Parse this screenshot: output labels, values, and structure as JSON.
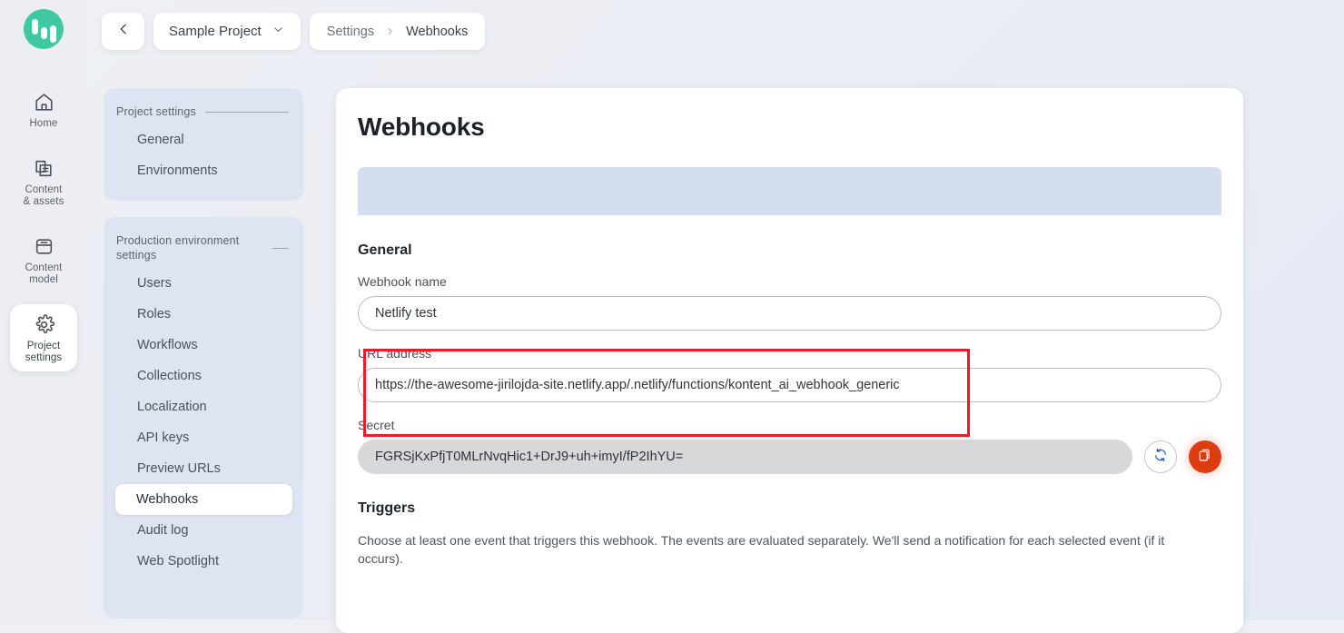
{
  "app": {
    "logo_name": "kontent-ai-logo",
    "accent_green": "#3ec9a3",
    "accent_orange": "#dd3c10",
    "accent_blue": "#2b58c4",
    "highlight_red": "#ed1c24",
    "banner_blue": "#d3deef",
    "panel_blue": "#dee4f1"
  },
  "rail": {
    "items": [
      {
        "label": "Home",
        "icon": "home-icon",
        "active": false
      },
      {
        "label": "Content\n& assets",
        "label_line1": "Content",
        "label_line2": "& assets",
        "icon": "content-assets-icon",
        "active": false
      },
      {
        "label": "Content\nmodel",
        "label_line1": "Content",
        "label_line2": "model",
        "icon": "content-model-icon",
        "active": false
      },
      {
        "label": "Project\nsettings",
        "label_line1": "Project",
        "label_line2": "settings",
        "icon": "gear-icon",
        "active": true
      }
    ]
  },
  "topbar": {
    "back_icon": "chevron-left-icon",
    "project_name": "Sample Project",
    "project_chevron": "chevron-down-icon",
    "breadcrumb": {
      "first": "Settings",
      "separator_icon": "chevron-right-icon",
      "last": "Webhooks"
    }
  },
  "settings_nav": {
    "groups": [
      {
        "heading": "Project settings",
        "items": [
          {
            "label": "General",
            "active": false
          },
          {
            "label": "Environments",
            "active": false
          }
        ]
      },
      {
        "heading": "Production environment settings",
        "items": [
          {
            "label": "Users",
            "active": false
          },
          {
            "label": "Roles",
            "active": false
          },
          {
            "label": "Workflows",
            "active": false
          },
          {
            "label": "Collections",
            "active": false
          },
          {
            "label": "Localization",
            "active": false
          },
          {
            "label": "API keys",
            "active": false
          },
          {
            "label": "Preview URLs",
            "active": false
          },
          {
            "label": "Webhooks",
            "active": true
          },
          {
            "label": "Audit log",
            "active": false
          },
          {
            "label": "Web Spotlight",
            "active": false
          }
        ]
      }
    ]
  },
  "main": {
    "page_title": "Webhooks",
    "general": {
      "section_title": "General",
      "name_label": "Webhook name",
      "name_value": "Netlify test",
      "url_label": "URL address",
      "url_value": "https://the-awesome-jirilojda-site.netlify.app/.netlify/functions/kontent_ai_webhook_generic",
      "secret_label": "Secret",
      "secret_value": "FGRSjKxPfjT0MLrNvqHic1+DrJ9+uh+imyI/fP2IhYU=",
      "regenerate_icon": "refresh-icon",
      "copy_icon": "copy-icon"
    },
    "triggers": {
      "section_title": "Triggers",
      "description": "Choose at least one event that triggers this webhook. The events are evaluated separately. We'll send a notification for each selected event (if it occurs)."
    }
  },
  "annotation": {
    "name": "url-address-highlight",
    "color": "#ed1c24"
  }
}
